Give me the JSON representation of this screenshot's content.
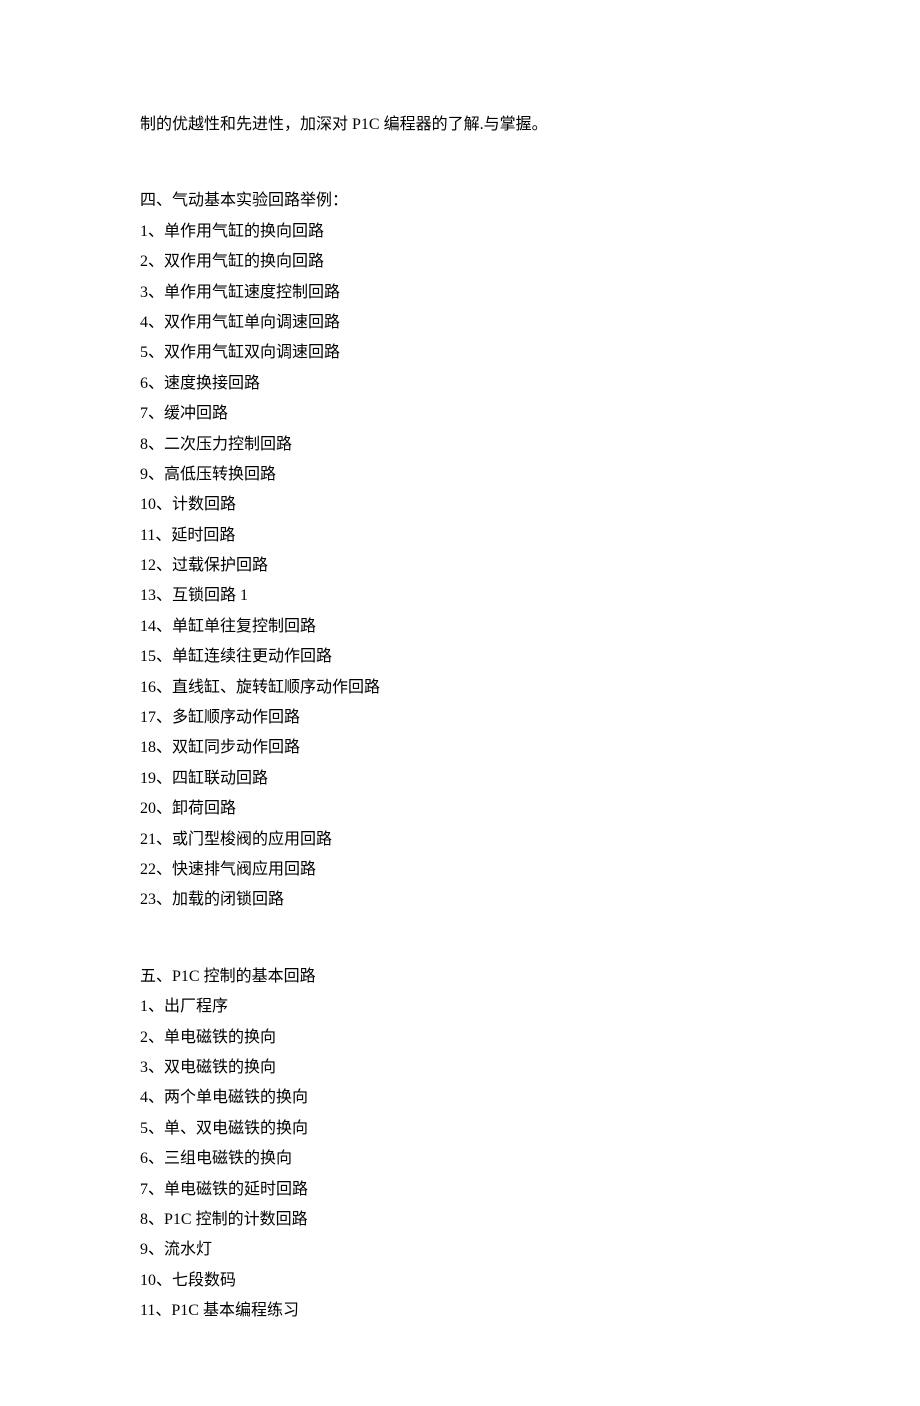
{
  "intro_line": "制的优越性和先进性，加深对 P1C 编程器的了解.与掌握。",
  "section4": {
    "heading": "四、气动基本实验回路举例：",
    "items": [
      "1、单作用气缸的换向回路",
      "2、双作用气缸的换向回路",
      "3、单作用气缸速度控制回路",
      "4、双作用气缸单向调速回路",
      "5、双作用气缸双向调速回路",
      "6、速度换接回路",
      "7、缓冲回路",
      "8、二次压力控制回路",
      "9、高低压转换回路",
      "10、计数回路",
      "11、延时回路",
      "12、过载保护回路",
      "13、互锁回路 1",
      "14、单缸单往复控制回路",
      "15、单缸连续往更动作回路",
      "16、直线缸、旋转缸顺序动作回路",
      "17、多缸顺序动作回路",
      "18、双缸同步动作回路",
      "19、四缸联动回路",
      "20、卸荷回路",
      "21、或门型梭阀的应用回路",
      "22、快速排气阀应用回路",
      "23、加载的闭锁回路"
    ]
  },
  "section5": {
    "heading": "五、P1C 控制的基本回路",
    "items": [
      "1、出厂程序",
      "2、单电磁铁的换向",
      "3、双电磁铁的换向",
      "4、两个单电磁铁的换向",
      "5、单、双电磁铁的换向",
      "6、三组电磁铁的换向",
      "7、单电磁铁的延时回路",
      "8、P1C 控制的计数回路",
      "9、流水灯",
      "10、七段数码",
      "11、P1C 基本编程练习"
    ]
  }
}
